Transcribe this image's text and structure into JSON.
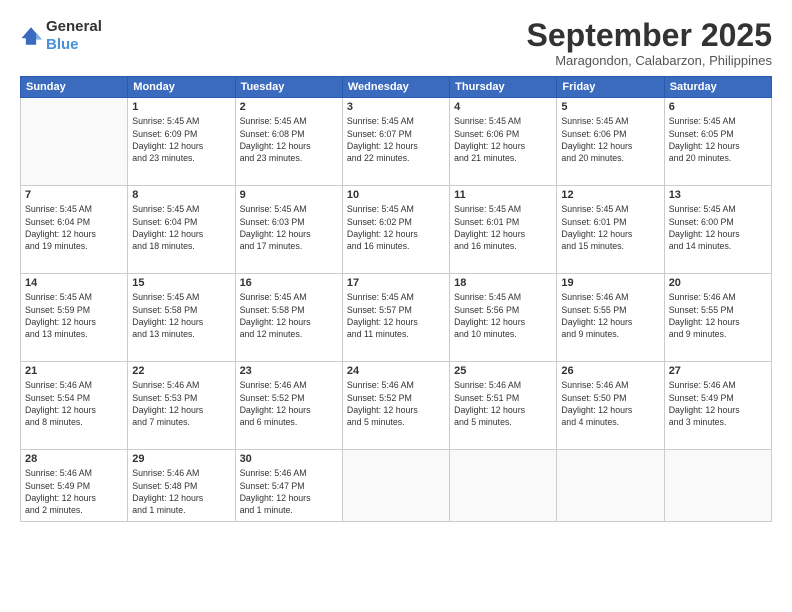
{
  "logo": {
    "general": "General",
    "blue": "Blue"
  },
  "title": "September 2025",
  "subtitle": "Maragondon, Calabarzon, Philippines",
  "weekdays": [
    "Sunday",
    "Monday",
    "Tuesday",
    "Wednesday",
    "Thursday",
    "Friday",
    "Saturday"
  ],
  "weeks": [
    [
      {
        "day": "",
        "info": ""
      },
      {
        "day": "1",
        "info": "Sunrise: 5:45 AM\nSunset: 6:09 PM\nDaylight: 12 hours\nand 23 minutes."
      },
      {
        "day": "2",
        "info": "Sunrise: 5:45 AM\nSunset: 6:08 PM\nDaylight: 12 hours\nand 23 minutes."
      },
      {
        "day": "3",
        "info": "Sunrise: 5:45 AM\nSunset: 6:07 PM\nDaylight: 12 hours\nand 22 minutes."
      },
      {
        "day": "4",
        "info": "Sunrise: 5:45 AM\nSunset: 6:06 PM\nDaylight: 12 hours\nand 21 minutes."
      },
      {
        "day": "5",
        "info": "Sunrise: 5:45 AM\nSunset: 6:06 PM\nDaylight: 12 hours\nand 20 minutes."
      },
      {
        "day": "6",
        "info": "Sunrise: 5:45 AM\nSunset: 6:05 PM\nDaylight: 12 hours\nand 20 minutes."
      }
    ],
    [
      {
        "day": "7",
        "info": "Sunrise: 5:45 AM\nSunset: 6:04 PM\nDaylight: 12 hours\nand 19 minutes."
      },
      {
        "day": "8",
        "info": "Sunrise: 5:45 AM\nSunset: 6:04 PM\nDaylight: 12 hours\nand 18 minutes."
      },
      {
        "day": "9",
        "info": "Sunrise: 5:45 AM\nSunset: 6:03 PM\nDaylight: 12 hours\nand 17 minutes."
      },
      {
        "day": "10",
        "info": "Sunrise: 5:45 AM\nSunset: 6:02 PM\nDaylight: 12 hours\nand 16 minutes."
      },
      {
        "day": "11",
        "info": "Sunrise: 5:45 AM\nSunset: 6:01 PM\nDaylight: 12 hours\nand 16 minutes."
      },
      {
        "day": "12",
        "info": "Sunrise: 5:45 AM\nSunset: 6:01 PM\nDaylight: 12 hours\nand 15 minutes."
      },
      {
        "day": "13",
        "info": "Sunrise: 5:45 AM\nSunset: 6:00 PM\nDaylight: 12 hours\nand 14 minutes."
      }
    ],
    [
      {
        "day": "14",
        "info": "Sunrise: 5:45 AM\nSunset: 5:59 PM\nDaylight: 12 hours\nand 13 minutes."
      },
      {
        "day": "15",
        "info": "Sunrise: 5:45 AM\nSunset: 5:58 PM\nDaylight: 12 hours\nand 13 minutes."
      },
      {
        "day": "16",
        "info": "Sunrise: 5:45 AM\nSunset: 5:58 PM\nDaylight: 12 hours\nand 12 minutes."
      },
      {
        "day": "17",
        "info": "Sunrise: 5:45 AM\nSunset: 5:57 PM\nDaylight: 12 hours\nand 11 minutes."
      },
      {
        "day": "18",
        "info": "Sunrise: 5:45 AM\nSunset: 5:56 PM\nDaylight: 12 hours\nand 10 minutes."
      },
      {
        "day": "19",
        "info": "Sunrise: 5:46 AM\nSunset: 5:55 PM\nDaylight: 12 hours\nand 9 minutes."
      },
      {
        "day": "20",
        "info": "Sunrise: 5:46 AM\nSunset: 5:55 PM\nDaylight: 12 hours\nand 9 minutes."
      }
    ],
    [
      {
        "day": "21",
        "info": "Sunrise: 5:46 AM\nSunset: 5:54 PM\nDaylight: 12 hours\nand 8 minutes."
      },
      {
        "day": "22",
        "info": "Sunrise: 5:46 AM\nSunset: 5:53 PM\nDaylight: 12 hours\nand 7 minutes."
      },
      {
        "day": "23",
        "info": "Sunrise: 5:46 AM\nSunset: 5:52 PM\nDaylight: 12 hours\nand 6 minutes."
      },
      {
        "day": "24",
        "info": "Sunrise: 5:46 AM\nSunset: 5:52 PM\nDaylight: 12 hours\nand 5 minutes."
      },
      {
        "day": "25",
        "info": "Sunrise: 5:46 AM\nSunset: 5:51 PM\nDaylight: 12 hours\nand 5 minutes."
      },
      {
        "day": "26",
        "info": "Sunrise: 5:46 AM\nSunset: 5:50 PM\nDaylight: 12 hours\nand 4 minutes."
      },
      {
        "day": "27",
        "info": "Sunrise: 5:46 AM\nSunset: 5:49 PM\nDaylight: 12 hours\nand 3 minutes."
      }
    ],
    [
      {
        "day": "28",
        "info": "Sunrise: 5:46 AM\nSunset: 5:49 PM\nDaylight: 12 hours\nand 2 minutes."
      },
      {
        "day": "29",
        "info": "Sunrise: 5:46 AM\nSunset: 5:48 PM\nDaylight: 12 hours\nand 1 minute."
      },
      {
        "day": "30",
        "info": "Sunrise: 5:46 AM\nSunset: 5:47 PM\nDaylight: 12 hours\nand 1 minute."
      },
      {
        "day": "",
        "info": ""
      },
      {
        "day": "",
        "info": ""
      },
      {
        "day": "",
        "info": ""
      },
      {
        "day": "",
        "info": ""
      }
    ]
  ]
}
